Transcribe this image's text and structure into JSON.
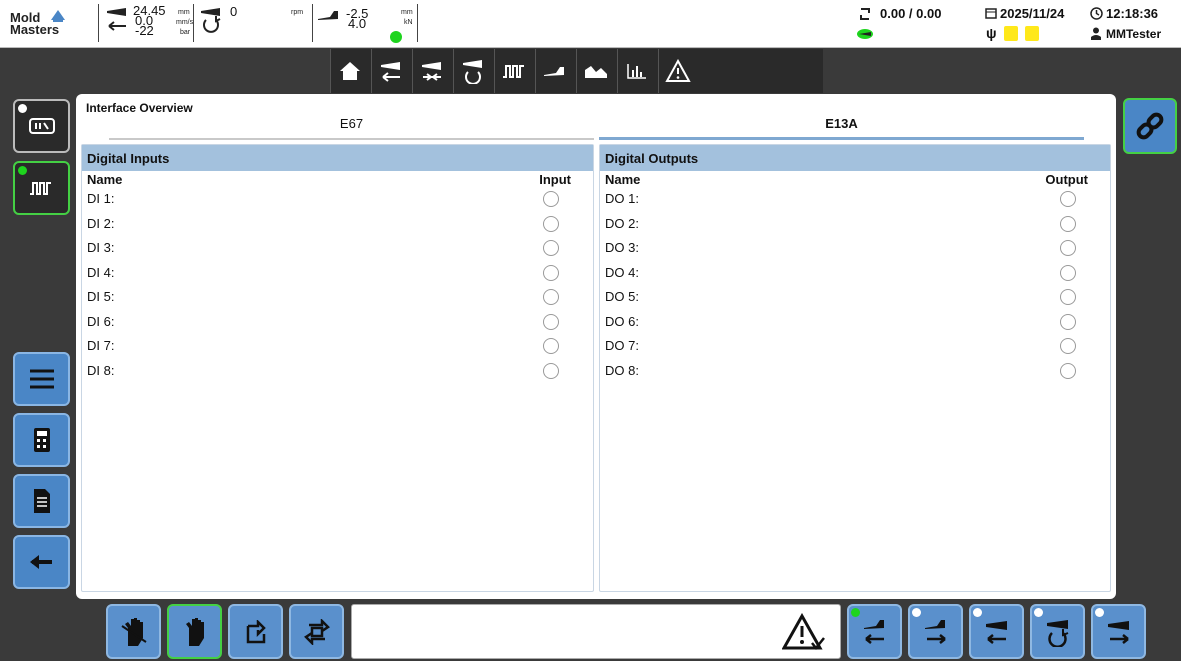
{
  "header": {
    "logo": {
      "line1": "Mold",
      "line2": "Masters"
    },
    "injection": {
      "position": "24.45",
      "speed": "0.0",
      "pressure": "-22",
      "unit_pos": "mm",
      "unit_speed": "mm/s",
      "unit_pressure": "bar"
    },
    "screw": {
      "rpm_value": "0",
      "unit": "rpm"
    },
    "carriage": {
      "position": "-2.5",
      "force": "4.0",
      "unit_pos": "mm",
      "unit_force": "kN"
    },
    "cycle": "0.00 / 0.00",
    "date": "2025/11/24",
    "time": "12:18:36",
    "user": "MMTester"
  },
  "nav": {
    "items": [
      "home-icon",
      "injection-retract-icon",
      "injection-hold-icon",
      "screw-rotate-icon",
      "digital-io-icon",
      "carriage-icon",
      "profile-chart-icon",
      "statistics-icon",
      "alarm-icon"
    ]
  },
  "main": {
    "title": "Interface Overview",
    "tabs": [
      {
        "label": "E67",
        "active": false
      },
      {
        "label": "E13A",
        "active": true
      }
    ],
    "inputs": {
      "header": "Digital Inputs",
      "col_name": "Name",
      "col_value": "Input",
      "rows": [
        "DI 1:",
        "DI 2:",
        "DI 3:",
        "DI 4:",
        "DI 5:",
        "DI 6:",
        "DI 7:",
        "DI 8:"
      ]
    },
    "outputs": {
      "header": "Digital Outputs",
      "col_name": "Name",
      "col_value": "Output",
      "rows": [
        "DO 1:",
        "DO 2:",
        "DO 3:",
        "DO 4:",
        "DO 5:",
        "DO 6:",
        "DO 7:",
        "DO 8:"
      ]
    }
  },
  "colors": {
    "accent_blue": "#4a86c6",
    "active_green": "#44d044",
    "panel_header": "#a3c1dd",
    "status_green": "#1ed41e"
  }
}
